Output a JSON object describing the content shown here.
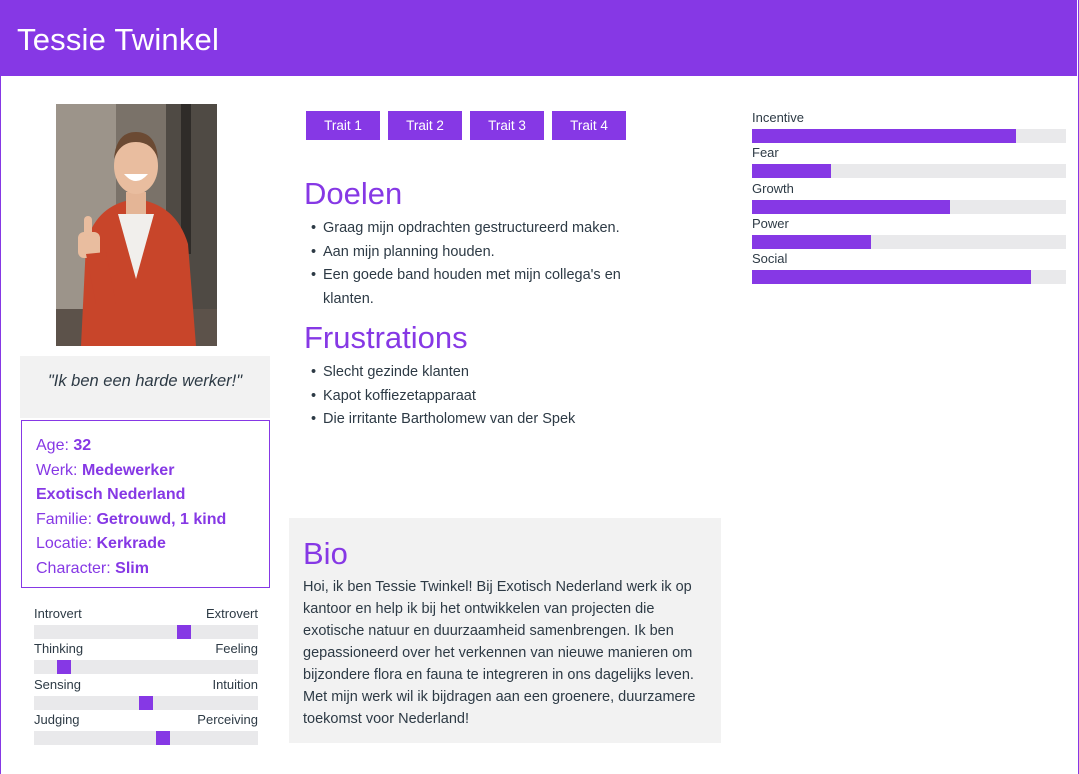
{
  "persona": {
    "name": "Tessie Twinkel",
    "quote": "\"Ik ben een harde werker!\""
  },
  "info": {
    "age_label": "Age:",
    "age_value": "32",
    "work_label": "Werk:",
    "work_value": "Medewerker Exotisch Nederland",
    "family_label": "Familie:",
    "family_value": "Getrouwd, 1 kind",
    "location_label": "Locatie:",
    "location_value": "Kerkrade",
    "character_label": "Character:",
    "character_value": "Slim"
  },
  "personality": [
    {
      "left": "Introvert",
      "right": "Extrovert",
      "value": 0.68
    },
    {
      "left": "Thinking",
      "right": "Feeling",
      "value": 0.11
    },
    {
      "left": "Sensing",
      "right": "Intuition",
      "value": 0.5
    },
    {
      "left": "Judging",
      "right": "Perceiving",
      "value": 0.58
    }
  ],
  "traits": [
    "Trait 1",
    "Trait 2",
    "Trait 3",
    "Trait 4"
  ],
  "goals": {
    "title": "Doelen",
    "items": [
      "Graag mijn opdrachten gestructureerd maken.",
      "Aan mijn planning houden.",
      "Een goede band houden met mijn collega's en klanten."
    ]
  },
  "frustrations": {
    "title": "Frustrations",
    "items": [
      "Slecht gezinde klanten",
      "Kapot koffiezetapparaat",
      "Die irritante Bartholomew van der Spek"
    ]
  },
  "bio": {
    "title": "Bio",
    "text": "Hoi, ik ben Tessie Twinkel! Bij Exotisch Nederland werk ik op kantoor en help ik bij het ontwikkelen van projecten die exotische natuur en duurzaamheid samenbrengen. Ik ben gepassioneerd over het verkennen van nieuwe manieren om bijzondere flora en fauna te integreren in ons dagelijks leven. Met mijn werk wil ik bijdragen aan een groenere, duurzamere toekomst voor Nederland!"
  },
  "motivations": [
    {
      "label": "Incentive",
      "value": 0.84
    },
    {
      "label": "Fear",
      "value": 0.25
    },
    {
      "label": "Growth",
      "value": 0.63
    },
    {
      "label": "Power",
      "value": 0.38
    },
    {
      "label": "Social",
      "value": 0.89
    }
  ],
  "colors": {
    "accent": "#8638e5",
    "track": "#e9e9eb",
    "panel": "#f2f2f2",
    "text": "#2d3a45"
  }
}
